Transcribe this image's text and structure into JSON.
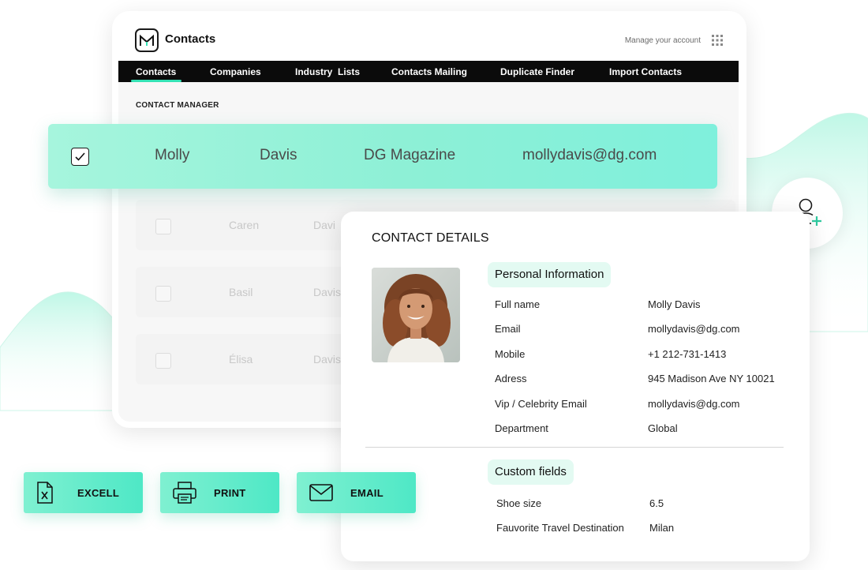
{
  "app": {
    "title": "Contacts",
    "manage_account": "Manage your account"
  },
  "nav": {
    "items": [
      {
        "label": "Contacts",
        "active": true
      },
      {
        "label": "Companies"
      },
      {
        "label": "Industry  Lists"
      },
      {
        "label": "Contacts Mailing"
      },
      {
        "label": "Duplicate Finder"
      },
      {
        "label": "Import Contacts"
      }
    ]
  },
  "manager": {
    "section_title": "CONTACT MANAGER",
    "selected_row": {
      "checked": true,
      "first_name": "Molly",
      "last_name": "Davis",
      "company": "DG Magazine",
      "email": "mollydavis@dg.com"
    },
    "other_rows": [
      {
        "first_name": "Caren",
        "last_name": "Davi"
      },
      {
        "first_name": "Basil",
        "last_name": "Davis"
      },
      {
        "first_name": "Élisa",
        "last_name": "Davis"
      }
    ]
  },
  "details": {
    "title": "CONTACT DETAILS",
    "personal_heading": "Personal Information",
    "personal": [
      {
        "label": "Full name",
        "value": "Molly Davis"
      },
      {
        "label": "Email",
        "value": "mollydavis@dg.com"
      },
      {
        "label": "Mobile",
        "value": "+1 212-731-1413"
      },
      {
        "label": "Adress",
        "value": "945 Madison Ave NY 10021"
      },
      {
        "label": "Vip / Celebrity Email",
        "value": "mollydavis@dg.com"
      },
      {
        "label": "Department",
        "value": "Global"
      }
    ],
    "custom_heading": "Custom fields",
    "custom": [
      {
        "label": "Shoe size",
        "value": "6.5"
      },
      {
        "label": "Fauvorite Travel Destination",
        "value": "Milan"
      }
    ]
  },
  "actions": [
    {
      "label": "EXCELL",
      "icon": "excel-icon"
    },
    {
      "label": "PRINT",
      "icon": "printer-icon"
    },
    {
      "label": "EMAIL",
      "icon": "envelope-icon"
    }
  ],
  "colors": {
    "accent": "#35e2b5",
    "highlight": "#8df0d6",
    "chip": "#e3faf2",
    "nav_bg": "#0b0b0b"
  }
}
